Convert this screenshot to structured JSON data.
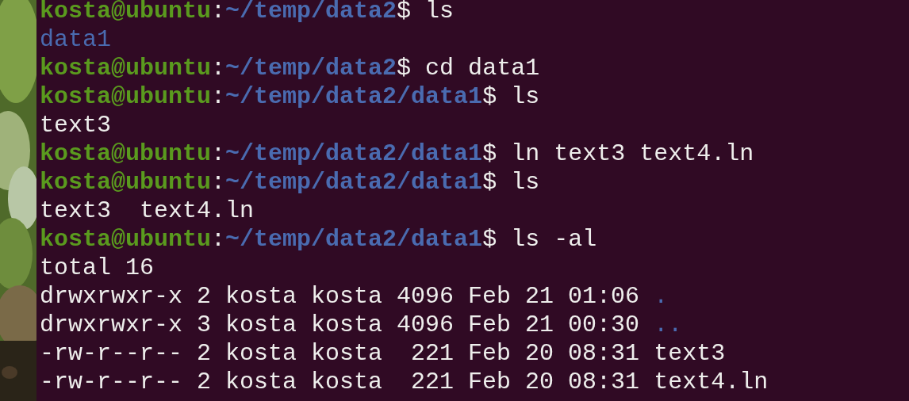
{
  "terminal": {
    "lines": [
      {
        "kind": "prompt",
        "user_host": "kosta@ubuntu",
        "separator": ":",
        "path": "~/temp/data2",
        "symbol": "$",
        "command": "ls"
      },
      {
        "kind": "output",
        "segments": [
          {
            "text": "data1",
            "kind": "directory"
          }
        ]
      },
      {
        "kind": "prompt",
        "user_host": "kosta@ubuntu",
        "separator": ":",
        "path": "~/temp/data2",
        "symbol": "$",
        "command": "cd data1"
      },
      {
        "kind": "prompt",
        "user_host": "kosta@ubuntu",
        "separator": ":",
        "path": "~/temp/data2/data1",
        "symbol": "$",
        "command": "ls"
      },
      {
        "kind": "output",
        "segments": [
          {
            "text": "text3",
            "kind": "file"
          }
        ]
      },
      {
        "kind": "prompt",
        "user_host": "kosta@ubuntu",
        "separator": ":",
        "path": "~/temp/data2/data1",
        "symbol": "$",
        "command": "ln text3 text4.ln"
      },
      {
        "kind": "prompt",
        "user_host": "kosta@ubuntu",
        "separator": ":",
        "path": "~/temp/data2/data1",
        "symbol": "$",
        "command": "ls"
      },
      {
        "kind": "output",
        "segments": [
          {
            "text": "text3  text4.ln",
            "kind": "file"
          }
        ]
      },
      {
        "kind": "prompt",
        "user_host": "kosta@ubuntu",
        "separator": ":",
        "path": "~/temp/data2/data1",
        "symbol": "$",
        "command": "ls -al"
      },
      {
        "kind": "output",
        "segments": [
          {
            "text": "total 16",
            "kind": "file"
          }
        ]
      },
      {
        "kind": "output",
        "segments": [
          {
            "text": "drwxrwxr-x 2 kosta kosta 4096 Feb 21 01:06 ",
            "kind": "file"
          },
          {
            "text": ".",
            "kind": "directory"
          }
        ]
      },
      {
        "kind": "output",
        "segments": [
          {
            "text": "drwxrwxr-x 3 kosta kosta 4096 Feb 21 00:30 ",
            "kind": "file"
          },
          {
            "text": "..",
            "kind": "directory"
          }
        ]
      },
      {
        "kind": "output",
        "segments": [
          {
            "text": "-rw-r--r-- 2 kosta kosta  221 Feb 20 08:31 text3",
            "kind": "file"
          }
        ]
      },
      {
        "kind": "output",
        "segments": [
          {
            "text": "-rw-r--r-- 2 kosta kosta  221 Feb 20 08:31 text4.ln",
            "kind": "file"
          }
        ]
      }
    ]
  }
}
